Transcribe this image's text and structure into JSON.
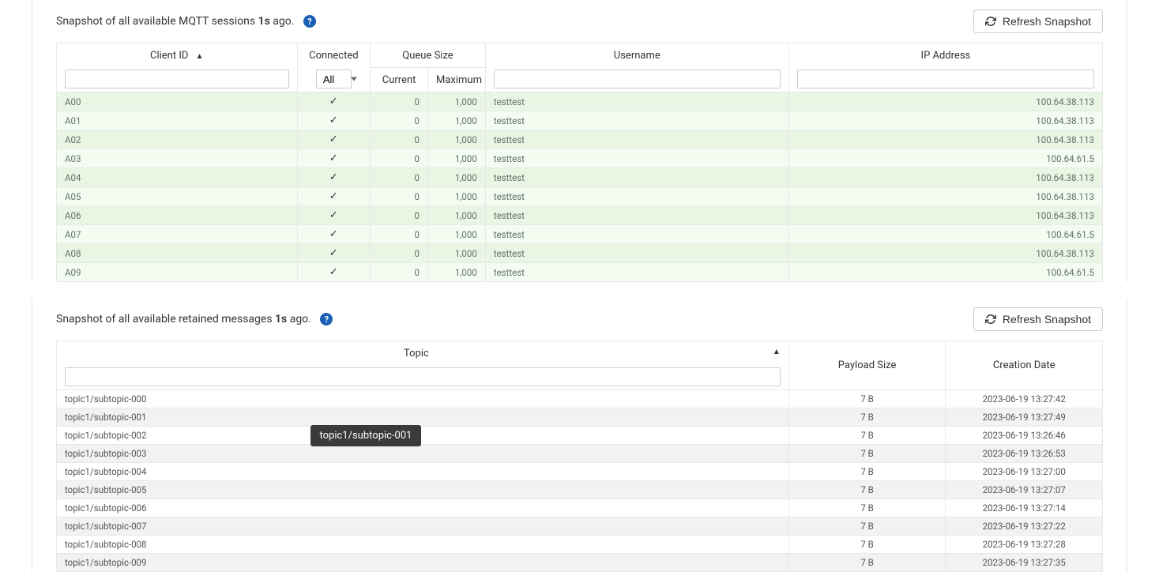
{
  "sessions_panel": {
    "text_prefix": "Snapshot of all available MQTT sessions ",
    "age": "1s",
    "text_suffix": " ago.",
    "refresh_label": "Refresh Snapshot",
    "headers": {
      "client_id": "Client ID",
      "connected": "Connected",
      "queue_size": "Queue Size",
      "current": "Current",
      "maximum": "Maximum",
      "username": "Username",
      "ip": "IP Address"
    },
    "connected_filter_value": "All",
    "rows": [
      {
        "client_id": "A00",
        "connected": true,
        "current": "0",
        "max": "1,000",
        "username": "testtest",
        "ip": "100.64.38.113"
      },
      {
        "client_id": "A01",
        "connected": true,
        "current": "0",
        "max": "1,000",
        "username": "testtest",
        "ip": "100.64.38.113"
      },
      {
        "client_id": "A02",
        "connected": true,
        "current": "0",
        "max": "1,000",
        "username": "testtest",
        "ip": "100.64.38.113"
      },
      {
        "client_id": "A03",
        "connected": true,
        "current": "0",
        "max": "1,000",
        "username": "testtest",
        "ip": "100.64.61.5"
      },
      {
        "client_id": "A04",
        "connected": true,
        "current": "0",
        "max": "1,000",
        "username": "testtest",
        "ip": "100.64.38.113"
      },
      {
        "client_id": "A05",
        "connected": true,
        "current": "0",
        "max": "1,000",
        "username": "testtest",
        "ip": "100.64.38.113"
      },
      {
        "client_id": "A06",
        "connected": true,
        "current": "0",
        "max": "1,000",
        "username": "testtest",
        "ip": "100.64.38.113"
      },
      {
        "client_id": "A07",
        "connected": true,
        "current": "0",
        "max": "1,000",
        "username": "testtest",
        "ip": "100.64.61.5"
      },
      {
        "client_id": "A08",
        "connected": true,
        "current": "0",
        "max": "1,000",
        "username": "testtest",
        "ip": "100.64.38.113"
      },
      {
        "client_id": "A09",
        "connected": true,
        "current": "0",
        "max": "1,000",
        "username": "testtest",
        "ip": "100.64.61.5"
      }
    ]
  },
  "retained_panel": {
    "text_prefix": "Snapshot of all available retained messages ",
    "age": "1s",
    "text_suffix": " ago.",
    "refresh_label": "Refresh Snapshot",
    "headers": {
      "topic": "Topic",
      "payload_size": "Payload Size",
      "creation_date": "Creation Date"
    },
    "tooltip_text": "topic1/subtopic-001",
    "rows": [
      {
        "topic": "topic1/subtopic-000",
        "size": "7 B",
        "created": "2023-06-19 13:27:42"
      },
      {
        "topic": "topic1/subtopic-001",
        "size": "7 B",
        "created": "2023-06-19 13:27:49"
      },
      {
        "topic": "topic1/subtopic-002",
        "size": "7 B",
        "created": "2023-06-19 13:26:46"
      },
      {
        "topic": "topic1/subtopic-003",
        "size": "7 B",
        "created": "2023-06-19 13:26:53"
      },
      {
        "topic": "topic1/subtopic-004",
        "size": "7 B",
        "created": "2023-06-19 13:27:00"
      },
      {
        "topic": "topic1/subtopic-005",
        "size": "7 B",
        "created": "2023-06-19 13:27:07"
      },
      {
        "topic": "topic1/subtopic-006",
        "size": "7 B",
        "created": "2023-06-19 13:27:14"
      },
      {
        "topic": "topic1/subtopic-007",
        "size": "7 B",
        "created": "2023-06-19 13:27:22"
      },
      {
        "topic": "topic1/subtopic-008",
        "size": "7 B",
        "created": "2023-06-19 13:27:28"
      },
      {
        "topic": "topic1/subtopic-009",
        "size": "7 B",
        "created": "2023-06-19 13:27:35"
      }
    ]
  }
}
